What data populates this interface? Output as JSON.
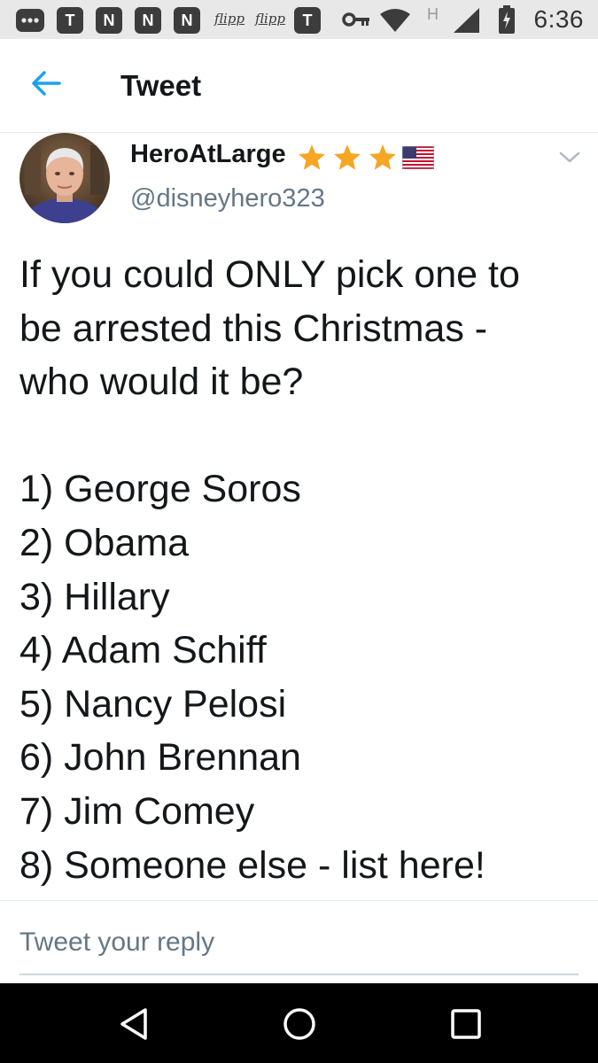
{
  "status_bar": {
    "time": "6:36",
    "icons": [
      "more-icon",
      "t-app-icon",
      "n-app-icon",
      "n-app-icon",
      "n-app-icon",
      "flipp-icon",
      "flipp-icon",
      "t-app-icon",
      "key-icon",
      "wifi-icon",
      "signal-icon",
      "battery-icon"
    ],
    "t_letter": "T",
    "n_letter": "N",
    "flipp_label": "flipp",
    "network_label": "H"
  },
  "header": {
    "title": "Tweet"
  },
  "tweet": {
    "author_name": "HeroAtLarge",
    "handle": "@disneyhero323",
    "badges": [
      "star-icon",
      "star-icon",
      "star-icon",
      "us-flag-icon"
    ],
    "text_lines": [
      "If you could ONLY pick one to",
      "be arrested this Christmas -",
      "who would it be?",
      "",
      "1) George Soros",
      "2) Obama",
      "3) Hillary",
      "4) Adam Schiff",
      "5) Nancy Pelosi",
      "6) John Brennan",
      "7) Jim Comey",
      "8) Someone else - list here!"
    ]
  },
  "reply": {
    "placeholder": "Tweet your reply"
  },
  "colors": {
    "accent": "#1da1f2",
    "star": "#f5a623",
    "text": "#14171a",
    "muted": "#657786"
  }
}
